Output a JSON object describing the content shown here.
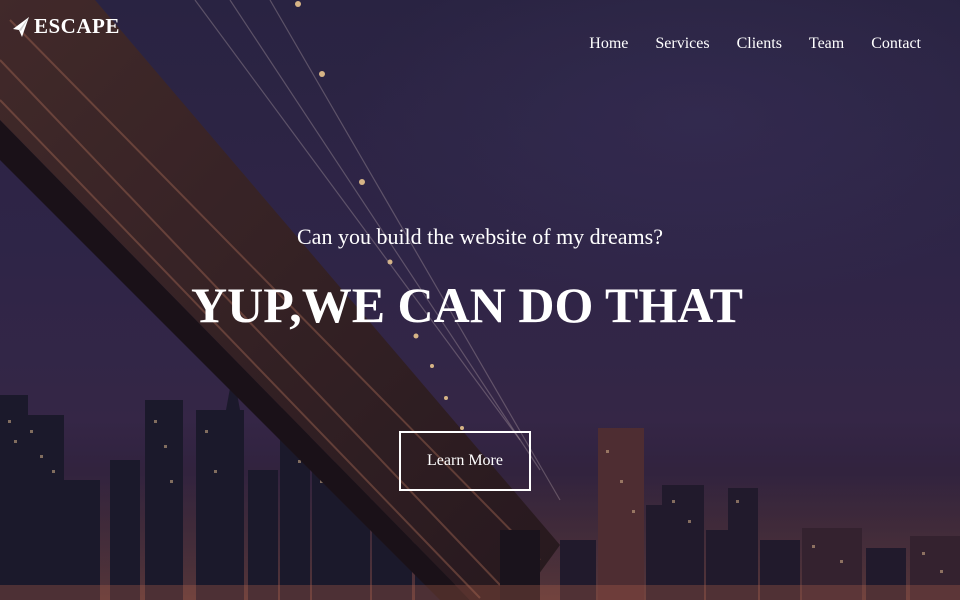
{
  "brand": {
    "name": "ESCAPE",
    "logo_icon": "paper-plane-icon"
  },
  "nav": {
    "items": [
      {
        "label": "Home"
      },
      {
        "label": "Services"
      },
      {
        "label": "Clients"
      },
      {
        "label": "Team"
      },
      {
        "label": "Contact"
      }
    ]
  },
  "hero": {
    "subtitle": "Can you build the website of my dreams?",
    "headline": "YUP,WE CAN DO THAT",
    "cta_label": "Learn More",
    "background": "night-city-bridge-image"
  },
  "colors": {
    "text": "#ffffff",
    "sky": "#2d2747"
  }
}
